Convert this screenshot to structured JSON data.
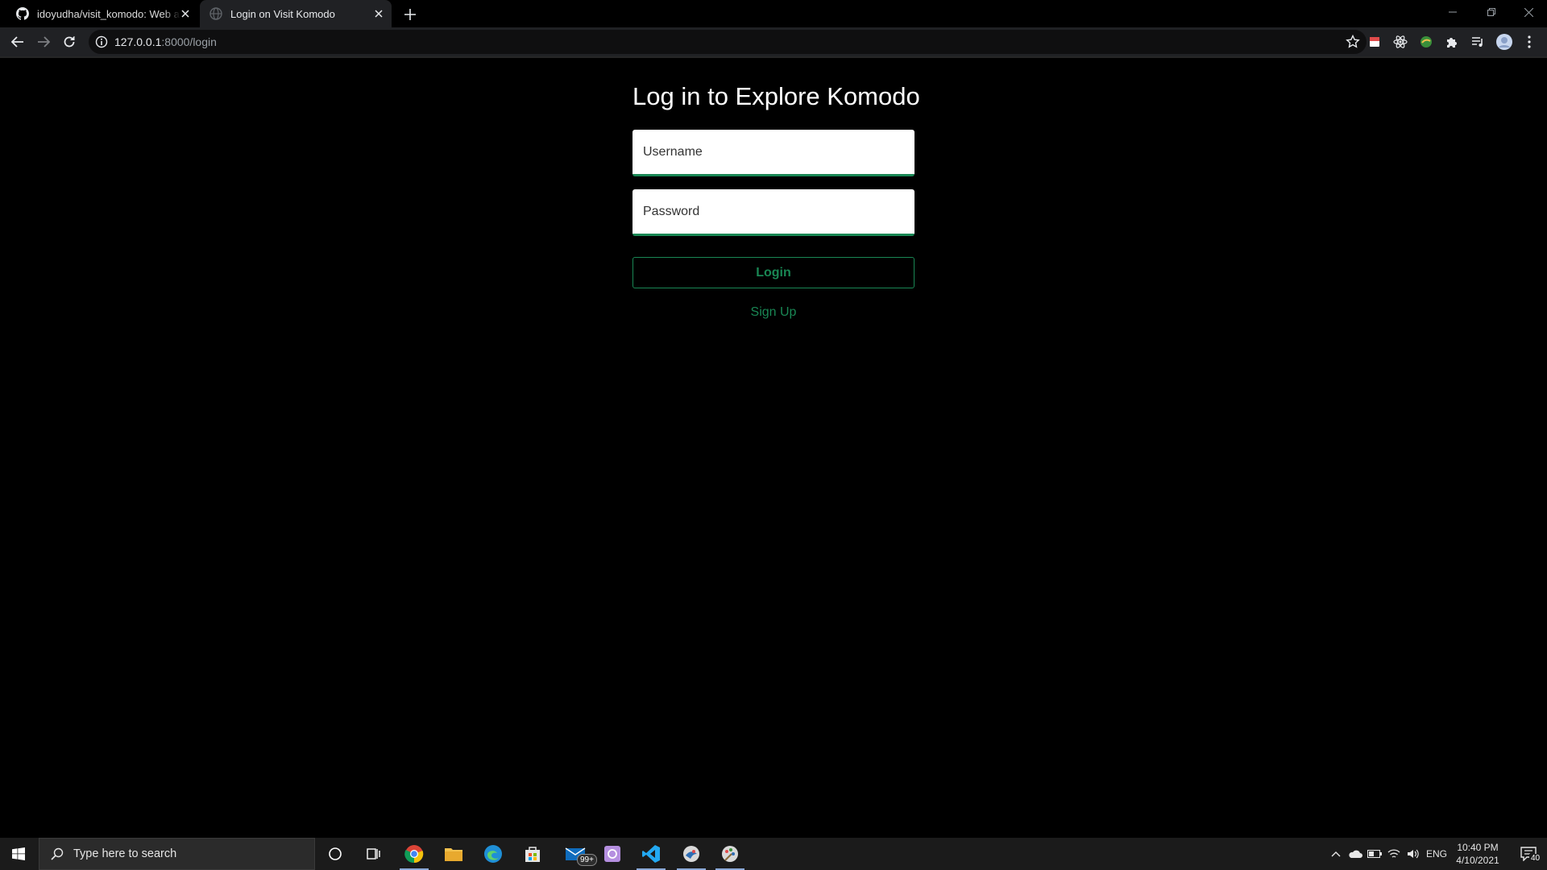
{
  "browser": {
    "tabs": [
      {
        "title": "idoyudha/visit_komodo: Web ap",
        "icon": "github-icon",
        "active": false
      },
      {
        "title": "Login on Visit Komodo",
        "icon": "globe-icon",
        "active": true
      }
    ],
    "address": {
      "host": "127.0.0.1",
      "path": ":8000/login"
    }
  },
  "page": {
    "title": "Log in to Explore Komodo",
    "username_placeholder": "Username",
    "password_placeholder": "Password",
    "login_label": "Login",
    "signup_label": "Sign Up",
    "accent_color": "#198754",
    "background_color": "#000000"
  },
  "taskbar": {
    "search_placeholder": "Type here to search",
    "mail_badge": "99+",
    "language": "ENG",
    "time": "10:40 PM",
    "date": "4/10/2021",
    "notification_count": "40"
  }
}
